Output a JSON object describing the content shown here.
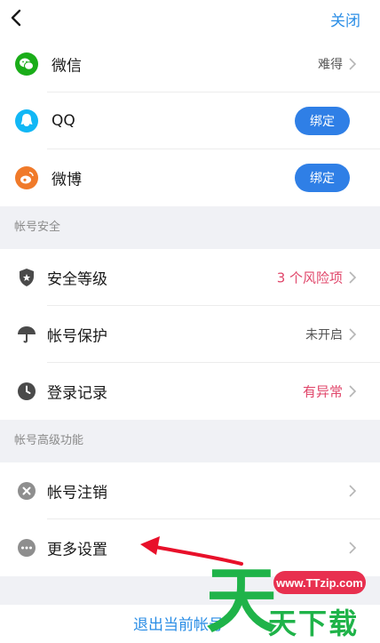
{
  "header": {
    "close_label": "关闭"
  },
  "bindings": {
    "items": [
      {
        "label": "微信",
        "value": "难得",
        "icon": "wechat-icon",
        "color": "#1aad19"
      },
      {
        "label": "QQ",
        "button": "绑定",
        "icon": "qq-icon",
        "color": "#12b7f5"
      },
      {
        "label": "微博",
        "button": "绑定",
        "icon": "weibo-icon",
        "color": "#f07a2a"
      }
    ]
  },
  "security": {
    "header": "帐号安全",
    "items": [
      {
        "label": "安全等级",
        "value": "3 个风险项",
        "icon": "shield-star-icon"
      },
      {
        "label": "帐号保护",
        "value": "未开启",
        "icon": "umbrella-icon"
      },
      {
        "label": "登录记录",
        "value": "有异常",
        "icon": "clock-icon"
      }
    ]
  },
  "advanced": {
    "header": "帐号高级功能",
    "items": [
      {
        "label": "帐号注销",
        "icon": "cancel-circle-icon"
      },
      {
        "label": "更多设置",
        "icon": "more-dots-icon"
      }
    ]
  },
  "footer": {
    "logout_label": "退出当前帐号"
  },
  "watermark": {
    "site": "www.TTzip.com",
    "big": "天",
    "small": "天下载"
  },
  "colors": {
    "accent": "#2b8ee6",
    "button": "#2f7fe6",
    "warning": "#e0466a",
    "arrow": "#e8102a"
  }
}
